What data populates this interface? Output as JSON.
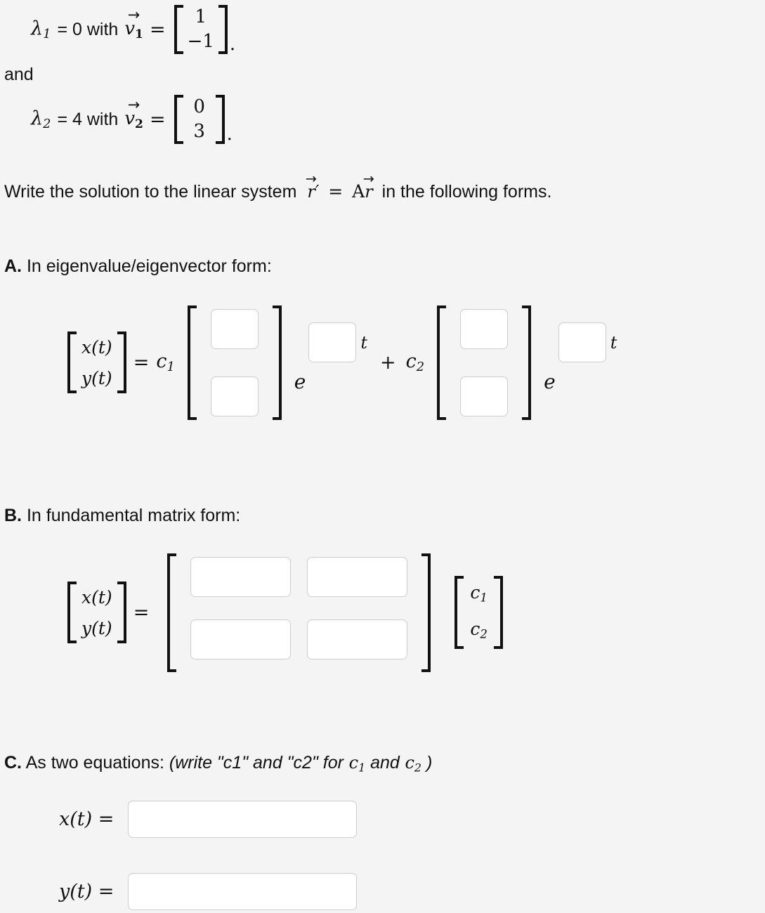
{
  "background_color": "#f4f4f4",
  "eigen": {
    "lines": [
      {
        "label": "λ1",
        "equation": "= 0 with",
        "vector_symbol": "v",
        "vector_index": "1",
        "arrow": "→",
        "entries": [
          "1",
          "−1"
        ],
        "trailing": "."
      },
      {
        "label": "λ2",
        "equation": "= 4 with",
        "vector_symbol": "v",
        "vector_index": "2",
        "arrow": "→",
        "entries": [
          "0",
          "3"
        ],
        "trailing": "."
      }
    ],
    "conjunction": "and"
  },
  "prompt": {
    "before": "Write the solution to the linear system",
    "system_lhs": "r",
    "prime": "′",
    "equals": "=",
    "system_rhs_matrix": "A",
    "system_rhs_vector": "r",
    "arrow": "→",
    "after": "in the following forms."
  },
  "sections": {
    "a": {
      "letter": "A.",
      "title": "In eigenvalue/eigenvector form:",
      "lhs_entries": [
        "x(t)",
        "y(t)"
      ],
      "equals": "=",
      "coef1": "c",
      "coef1_sub": "1",
      "coef2": "c",
      "coef2_sub": "2",
      "plus": "+",
      "e_base": "e",
      "exponent_var": "t",
      "vector1_blanks": [
        "",
        ""
      ],
      "vector2_blanks": [
        "",
        ""
      ],
      "exp1_blank": "",
      "exp2_blank": "",
      "blank_placeholder": ""
    },
    "b": {
      "letter": "B.",
      "title": "In fundamental matrix form:",
      "lhs_entries": [
        "x(t)",
        "y(t)"
      ],
      "equals": "=",
      "matrix_blanks": [
        "",
        "",
        "",
        ""
      ],
      "c_vector": [
        "c",
        "c"
      ],
      "c_vector_subs": [
        "1",
        "2"
      ],
      "blank_placeholder": ""
    },
    "c": {
      "letter": "C.",
      "title_plain": "As two equations:",
      "title_italic_1": "(write \"c1\" and \"c2\" for",
      "title_c1": "c",
      "title_c1_sub": "1",
      "title_and": "and",
      "title_c2": "c",
      "title_c2_sub": "2",
      "title_close": ")",
      "rows": [
        {
          "lhs": "x(t) =",
          "value": "",
          "placeholder": ""
        },
        {
          "lhs": "y(t) =",
          "value": "",
          "placeholder": ""
        }
      ]
    }
  }
}
